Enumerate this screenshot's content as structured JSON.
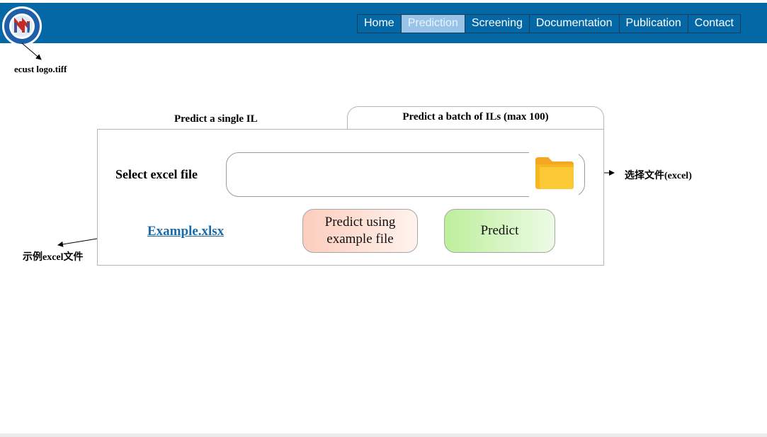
{
  "header": {
    "background_color": "#0568a6",
    "logo_icon": "university-seal-logo",
    "nav": [
      {
        "label": "Home",
        "active": false
      },
      {
        "label": "Prediction",
        "active": true
      },
      {
        "label": "Screening",
        "active": false
      },
      {
        "label": "Documentation",
        "active": false
      },
      {
        "label": "Publication",
        "active": false
      },
      {
        "label": "Contact",
        "active": false
      }
    ]
  },
  "annotations": {
    "logo_note": "ecust logo.tiff",
    "select_file_note": "选择文件(excel)",
    "example_note": "示例excel文件"
  },
  "tabs": {
    "single": "Predict a single IL",
    "batch": "Predict a batch of ILs (max 100)"
  },
  "form": {
    "select_label": "Select excel file",
    "file_value": "",
    "folder_icon": "folder-icon",
    "example_link": "Example.xlsx",
    "example_button": "Predict using example file",
    "predict_button": "Predict"
  },
  "colors": {
    "nav_active": "#99c4e8",
    "link": "#1a6aa8",
    "example_button_gradient": [
      "#fccdbd",
      "#fff3ee"
    ],
    "predict_button_gradient": [
      "#bdef9b",
      "#edfbe6"
    ],
    "folder": "#fbc02d"
  }
}
